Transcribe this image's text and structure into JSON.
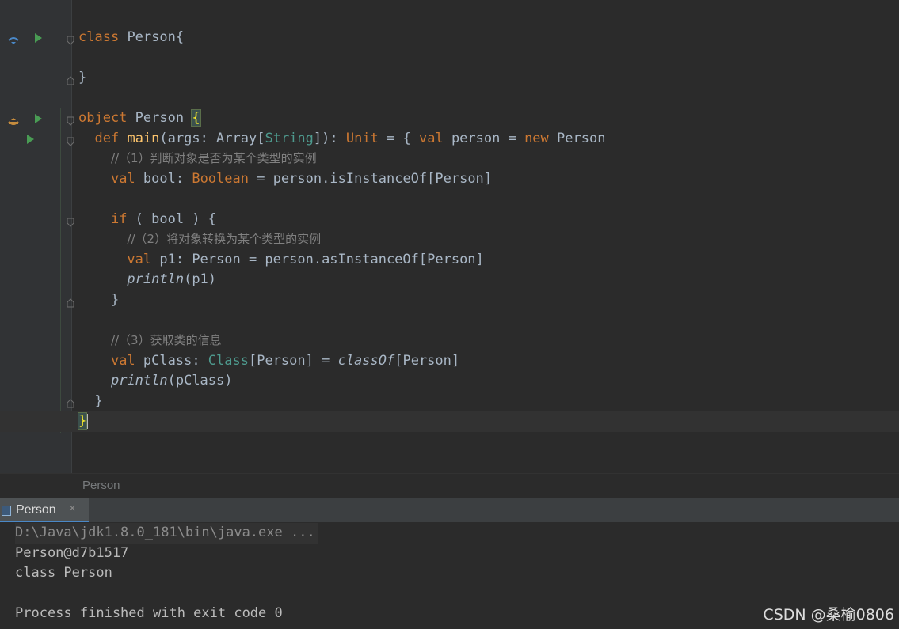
{
  "editor": {
    "class_kw": "class",
    "class_name": "Person{",
    "class_close": "}",
    "obj_kw": "object",
    "obj_name": "Person ",
    "obj_open": "{",
    "def_kw": "def",
    "main_name": "main",
    "main_args": "(args: Array[",
    "main_string": "String",
    "main_args_end": "]): ",
    "unit_kw": "Unit",
    "main_eq": " = { ",
    "val_kw": "val",
    "main_person": " person = ",
    "new_kw": "new",
    "main_person_end": " Person",
    "comment1": "//（1）判断对象是否为某个类型的实例",
    "bool_decl": " bool: ",
    "boolean_kw": "Boolean",
    "bool_rest": " = person.isInstanceOf[Person]",
    "if_kw": "if",
    "if_rest": " ( bool ) {",
    "comment2": "//（2）将对象转换为某个类型的实例",
    "p1_decl": " p1: Person = person.asInstanceOf[Person]",
    "println": "println",
    "println_p1": "(p1)",
    "if_close": "}",
    "comment3": "//（3）获取类的信息",
    "pclass_decl": " pClass: ",
    "class_type": "Class",
    "pclass_mid": "[Person] = ",
    "classof": "classOf",
    "pclass_end": "[Person]",
    "println_pclass": "(pClass)",
    "main_close": "}",
    "obj_close": "}"
  },
  "breadcrumb": {
    "label": "Person"
  },
  "run_tab": {
    "label": "Person",
    "close": "×"
  },
  "console": {
    "lines": [
      "D:\\Java\\jdk1.8.0_181\\bin\\java.exe ...",
      "Person@d7b1517",
      "class Person",
      "",
      "Process finished with exit code 0"
    ]
  },
  "watermark": "CSDN @桑榆0806"
}
